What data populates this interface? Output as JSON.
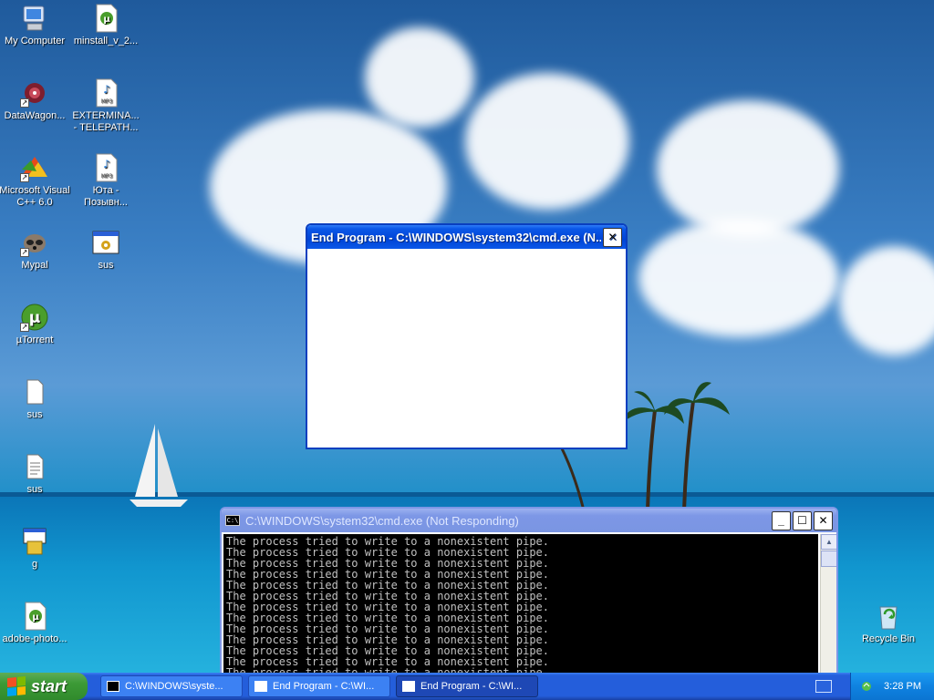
{
  "desktop": {
    "icons": [
      {
        "label": "My Computer"
      },
      {
        "label": "minstall_v_2..."
      },
      {
        "label": "DataWagon..."
      },
      {
        "label": "EXTERMINA...",
        "label2": "- TELEPATH..."
      },
      {
        "label": "Microsoft Visual",
        "label2": "C++ 6.0"
      },
      {
        "label": "Юта -",
        "label2": "Позывн..."
      },
      {
        "label": "Mypal"
      },
      {
        "label": "sus"
      },
      {
        "label": "µTorrent"
      },
      {
        "label": "sus"
      },
      {
        "label": "sus"
      },
      {
        "label": "g"
      },
      {
        "label": "adobe-photo..."
      },
      {
        "label": "Recycle Bin"
      }
    ]
  },
  "end_program_dialog": {
    "title": "End Program - C:\\WINDOWS\\system32\\cmd.exe (N..."
  },
  "cmd_window": {
    "title": "C:\\WINDOWS\\system32\\cmd.exe (Not Responding)",
    "line": "The process tried to write to a nonexistent pipe.",
    "line_count": 13
  },
  "taskbar": {
    "start_label": "start",
    "tasks": [
      {
        "label": "C:\\WINDOWS\\syste..."
      },
      {
        "label": "End Program - C:\\WI..."
      },
      {
        "label": "End Program - C:\\WI..."
      }
    ],
    "clock": "3:28 PM"
  },
  "colors": {
    "xp_blue": "#0044d6",
    "close_red": "#e04f22",
    "start_green": "#3c9a36"
  }
}
